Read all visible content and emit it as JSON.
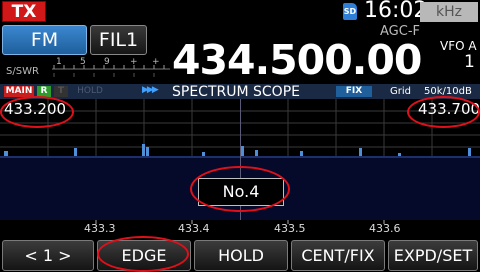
{
  "status_bar": {
    "tx_label": "TX",
    "sd_label": "SD",
    "time": "16:02",
    "unit": "kHz"
  },
  "mode_buttons": {
    "mode": "FM",
    "filter": "FIL1"
  },
  "display": {
    "agc": "AGC-F",
    "frequency": "434.500.00",
    "vfo_label": "VFO A",
    "vfo_number": "1"
  },
  "smeter": {
    "label": "S/SWR",
    "scale": [
      "1",
      "5",
      "9",
      "+",
      "+"
    ]
  },
  "scope_bar": {
    "main": "MAIN",
    "r": "R",
    "t": "T",
    "hold": "HOLD",
    "arrows": "▶▶▶",
    "title": "SPECTRUM SCOPE",
    "fix": "FIX",
    "grid": "Grid",
    "range": "50k/10dB"
  },
  "scope": {
    "edge_low": "433.200",
    "edge_high": "433.700",
    "memory_label": "No.4",
    "tick_labels": [
      "433.3",
      "433.4",
      "433.5",
      "433.6"
    ]
  },
  "softkeys": {
    "k1": "< 1 >",
    "k2": "EDGE",
    "k3": "HOLD",
    "k4": "CENT/FIX",
    "k5": "EXPD/SET"
  },
  "colors": {
    "tx": "#d01818",
    "active_button": "#2f74b8",
    "annotation": "#e0101a",
    "signal": "#4f8fd8"
  }
}
